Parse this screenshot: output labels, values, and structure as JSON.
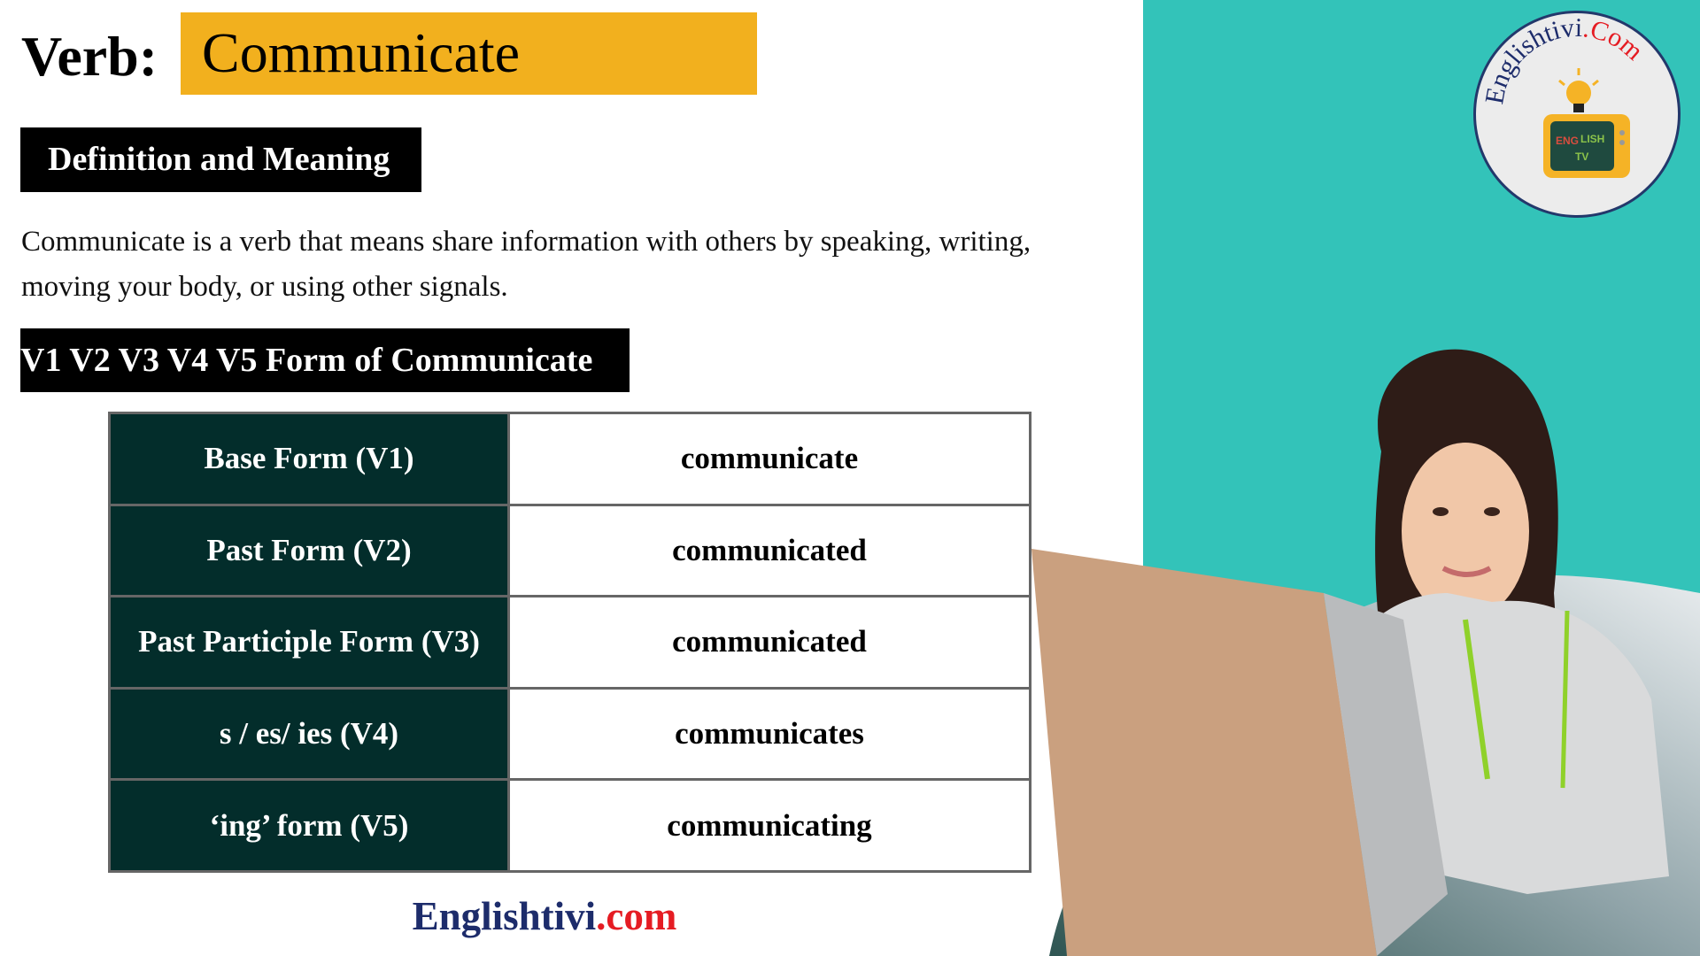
{
  "header": {
    "label": "Verb:",
    "word": "Communicate",
    "highlight_color": "#f2b01e"
  },
  "definition": {
    "heading": "Definition and Meaning",
    "text_line1": "Communicate is a verb that means share information with others by speaking, writing,",
    "text_line2": "moving your body, or using other signals."
  },
  "forms": {
    "heading": "V1 V2 V3 V4 V5 Form of Communicate",
    "rows": [
      {
        "label": "Base Form (V1)",
        "value": "communicate"
      },
      {
        "label": "Past Form (V2)",
        "value": "communicated"
      },
      {
        "label": "Past Participle Form (V3)",
        "value": "communicated"
      },
      {
        "label": "s / es/ ies (V4)",
        "value": "communicates"
      },
      {
        "label": "‘ing’ form (V5)",
        "value": "communicating"
      }
    ]
  },
  "footer": {
    "brand": "Englishtivi",
    "tld": ".com"
  },
  "logo": {
    "text_main": "Englishtivi",
    "text_tld": ".Com",
    "icon": "tv-lightbulb-icon"
  },
  "colors": {
    "teal": "#33c3b9",
    "table_dark": "#032d2b",
    "brand_blue": "#1d2c6b",
    "brand_red": "#e51c23"
  }
}
